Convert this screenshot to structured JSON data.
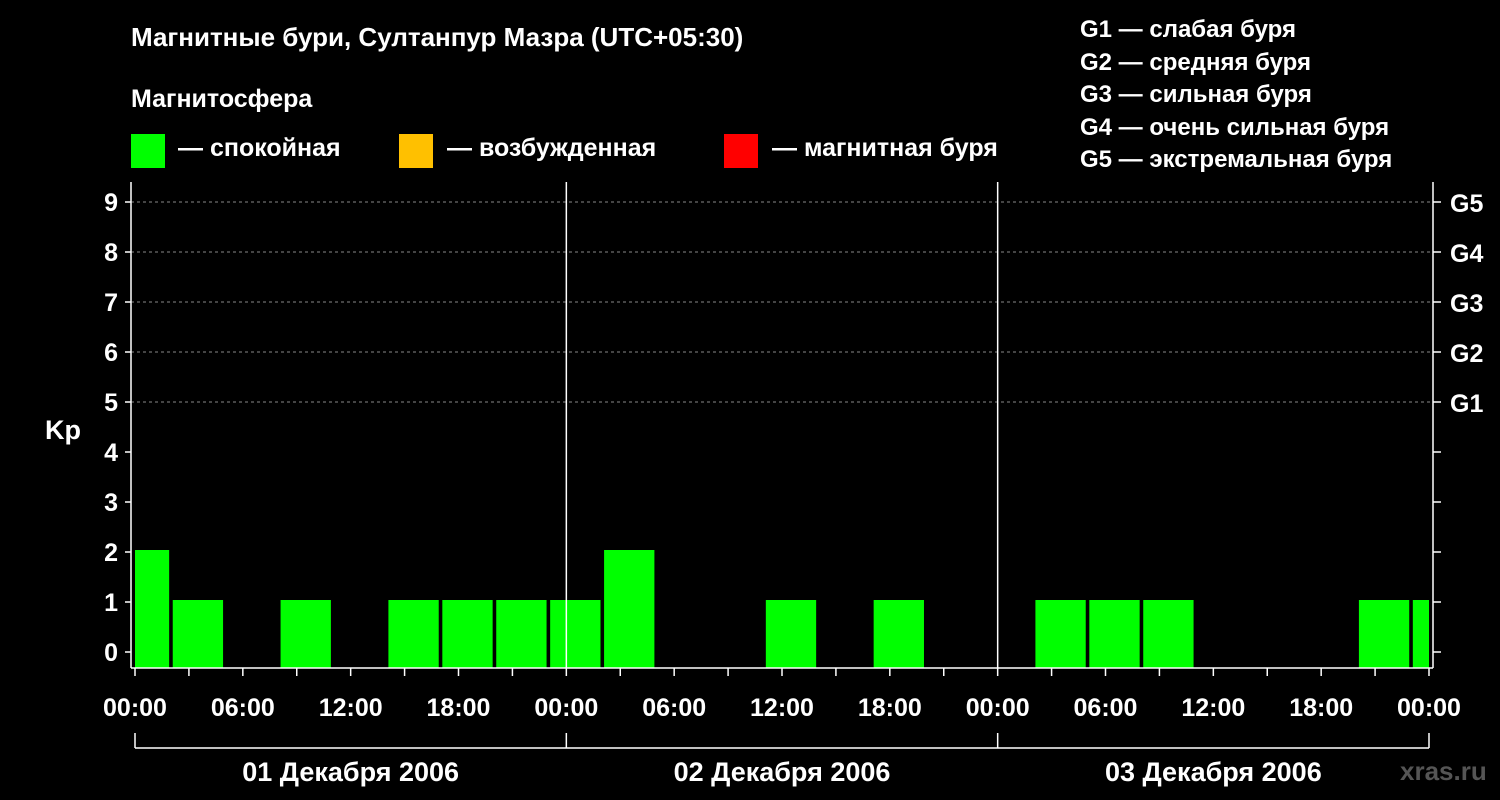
{
  "title": "Магнитные бури, Султанпур Мазра (UTC+05:30)",
  "subtitle": "Магнитосфера",
  "legend": [
    {
      "label": "— спокойная",
      "color": "#00ff00"
    },
    {
      "label": "— возбужденная",
      "color": "#ffc000"
    },
    {
      "label": "— магнитная буря",
      "color": "#ff0000"
    }
  ],
  "g_scale": [
    "G1 — слабая буря",
    "G2 — средняя буря",
    "G3 — сильная буря",
    "G4 — очень сильная буря",
    "G5 — экстремальная буря"
  ],
  "brand": "xras.ru",
  "chart_data": {
    "type": "bar",
    "ylabel": "Kp",
    "ylim": [
      0,
      9
    ],
    "yticks": [
      0,
      1,
      2,
      3,
      4,
      5,
      6,
      7,
      8,
      9
    ],
    "right_ticks": [
      {
        "value": 5,
        "label": "G1"
      },
      {
        "value": 6,
        "label": "G2"
      },
      {
        "value": 7,
        "label": "G3"
      },
      {
        "value": 8,
        "label": "G4"
      },
      {
        "value": 9,
        "label": "G5"
      }
    ],
    "xlim_hours": [
      0,
      72
    ],
    "xtick_labels": [
      "00:00",
      "06:00",
      "12:00",
      "18:00",
      "00:00",
      "06:00",
      "12:00",
      "18:00",
      "00:00",
      "06:00",
      "12:00",
      "18:00",
      "00:00"
    ],
    "day_labels": [
      "01 Декабря 2006",
      "02 Декабря 2006",
      "03 Декабря 2006"
    ],
    "grid": "dashed horizontal",
    "bar_color": "#00ff00",
    "bars": [
      {
        "start_hour": 0,
        "end_hour": 1.9,
        "kp": 2
      },
      {
        "start_hour": 2.1,
        "end_hour": 4.9,
        "kp": 1
      },
      {
        "start_hour": 8.1,
        "end_hour": 10.9,
        "kp": 1
      },
      {
        "start_hour": 14.1,
        "end_hour": 16.9,
        "kp": 1
      },
      {
        "start_hour": 17.1,
        "end_hour": 19.9,
        "kp": 1
      },
      {
        "start_hour": 20.1,
        "end_hour": 22.9,
        "kp": 1
      },
      {
        "start_hour": 23.1,
        "end_hour": 25.9,
        "kp": 1
      },
      {
        "start_hour": 26.1,
        "end_hour": 28.9,
        "kp": 2
      },
      {
        "start_hour": 35.1,
        "end_hour": 37.9,
        "kp": 1
      },
      {
        "start_hour": 41.1,
        "end_hour": 43.9,
        "kp": 1
      },
      {
        "start_hour": 50.1,
        "end_hour": 52.9,
        "kp": 1
      },
      {
        "start_hour": 53.1,
        "end_hour": 55.9,
        "kp": 1
      },
      {
        "start_hour": 56.1,
        "end_hour": 58.9,
        "kp": 1
      },
      {
        "start_hour": 68.1,
        "end_hour": 70.9,
        "kp": 1
      },
      {
        "start_hour": 71.1,
        "end_hour": 72,
        "kp": 1
      }
    ]
  }
}
